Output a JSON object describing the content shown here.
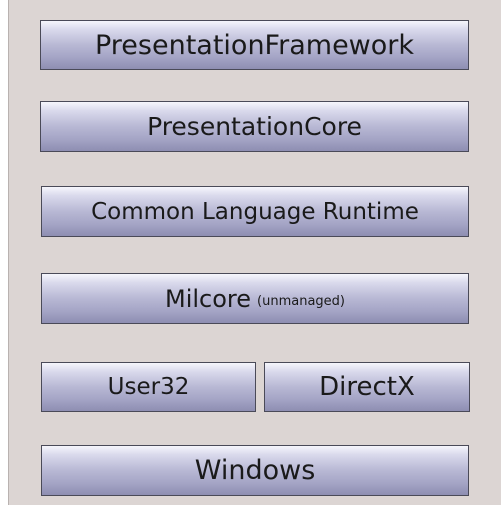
{
  "layers": {
    "presentation_framework": "PresentationFramework",
    "presentation_core": "PresentationCore",
    "clr": "Common Language Runtime",
    "milcore": "Milcore",
    "milcore_note": "(unmanaged)",
    "user32": "User32",
    "directx": "DirectX",
    "windows": "Windows"
  },
  "colors": {
    "background": "#dcd5d3",
    "box_gradient_top": "#f6f6fc",
    "box_gradient_bottom": "#8e8eb2",
    "box_border": "#4a4a58"
  }
}
